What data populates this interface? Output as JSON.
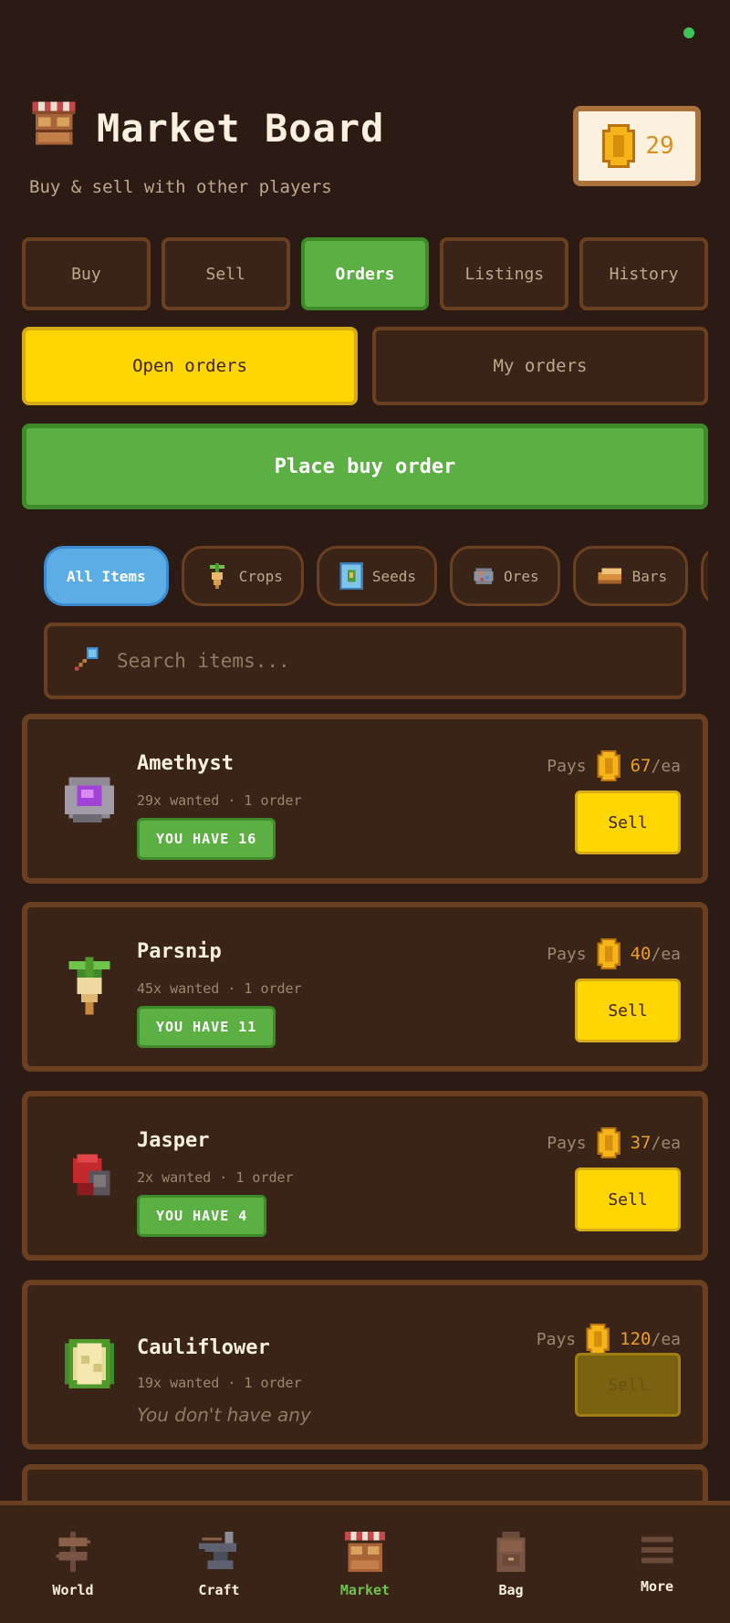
{
  "header": {
    "title": "Market Board",
    "subtitle": "Buy & sell with other players",
    "coins": "29"
  },
  "tabs": [
    {
      "label": "Buy"
    },
    {
      "label": "Sell"
    },
    {
      "label": "Orders",
      "active": true
    },
    {
      "label": "Listings"
    },
    {
      "label": "History"
    }
  ],
  "sub_tabs": [
    {
      "label": "Open orders",
      "active": true
    },
    {
      "label": "My orders"
    }
  ],
  "place_order_label": "Place buy order",
  "filters": [
    {
      "label": "All Items",
      "icon": "none",
      "active": true
    },
    {
      "label": "Crops",
      "icon": "crop-icon"
    },
    {
      "label": "Seeds",
      "icon": "seed-packet-icon"
    },
    {
      "label": "Ores",
      "icon": "ore-icon"
    },
    {
      "label": "Bars",
      "icon": "bar-icon"
    }
  ],
  "search": {
    "placeholder": "Search items..."
  },
  "items": [
    {
      "name": "Amethyst",
      "meta": "29x wanted · 1 order",
      "have": "YOU HAVE 16",
      "pays_label": "Pays",
      "price": "67",
      "unit": "/ea",
      "sell": "Sell"
    },
    {
      "name": "Parsnip",
      "meta": "45x wanted · 1 order",
      "have": "YOU HAVE 11",
      "pays_label": "Pays",
      "price": "40",
      "unit": "/ea",
      "sell": "Sell"
    },
    {
      "name": "Jasper",
      "meta": "2x wanted · 1 order",
      "have": "YOU HAVE 4",
      "pays_label": "Pays",
      "price": "37",
      "unit": "/ea",
      "sell": "Sell"
    },
    {
      "name": "Cauliflower",
      "meta": "19x wanted · 1 order",
      "nohave": "You don't have any",
      "pays_label": "Pays",
      "price": "120",
      "unit": "/ea",
      "sell": "Sell"
    }
  ],
  "nav": [
    {
      "label": "World"
    },
    {
      "label": "Craft"
    },
    {
      "label": "Market",
      "active": true
    },
    {
      "label": "Bag"
    },
    {
      "label": "More"
    }
  ],
  "colors": {
    "background": "#2c1a14",
    "panel": "#3a2418",
    "border": "#6b4020",
    "green": "#5caf42",
    "yellow": "#ffd600",
    "blue": "#5cade6",
    "gold": "#e8a126"
  }
}
